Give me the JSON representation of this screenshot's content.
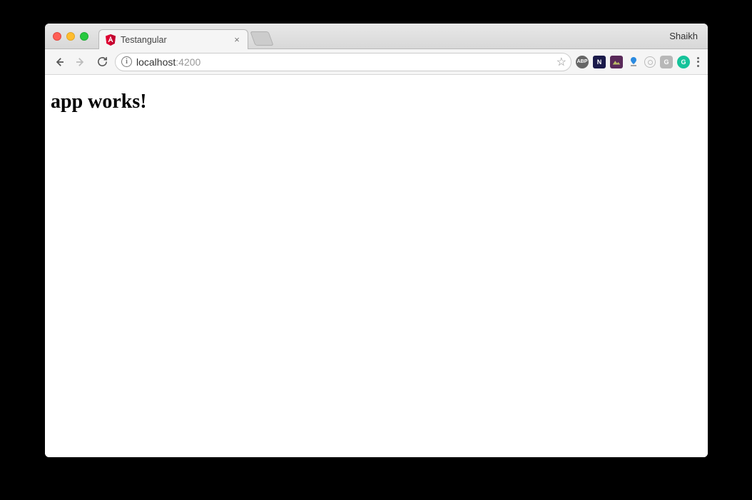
{
  "window": {
    "profile_name": "Shaikh"
  },
  "tab": {
    "title": "Testangular",
    "favicon_letter": "A",
    "close_glyph": "×"
  },
  "address": {
    "info_glyph": "i",
    "url_host": "localhost",
    "url_port": ":4200",
    "star_glyph": "☆"
  },
  "extensions": {
    "abp": "ABP",
    "n": "N",
    "g": "G",
    "gram": "G"
  },
  "page": {
    "heading": "app works!"
  }
}
